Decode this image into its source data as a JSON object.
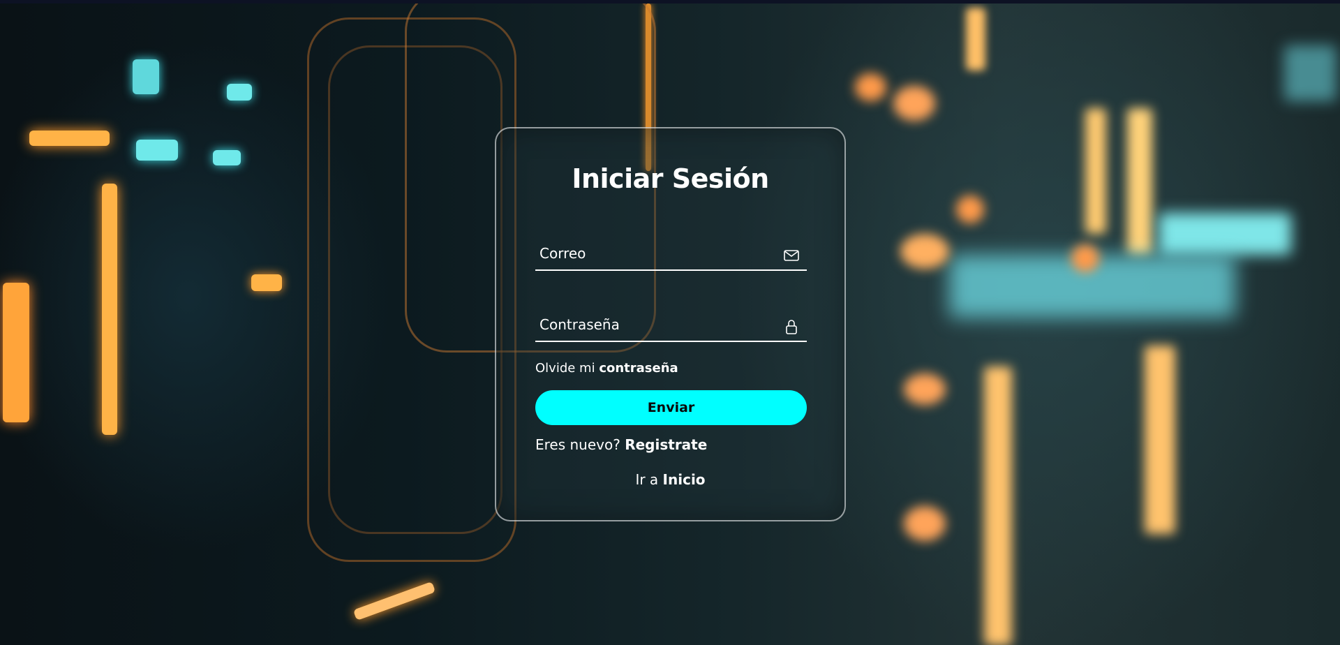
{
  "login": {
    "title": "Iniciar Sesión",
    "email_placeholder": "Correo",
    "password_placeholder": "Contraseña",
    "forgot_prefix": "Olvide mi",
    "forgot_link": "contraseña",
    "submit_label": "Enviar",
    "register_prefix": "Eres nuevo?",
    "register_link": "Registrate",
    "home_prefix": "Ir a",
    "home_link": "Inicio"
  },
  "icons": {
    "email": "mail-icon",
    "password": "lock-icon"
  },
  "colors": {
    "accent": "#00ffff",
    "card_border": "#ffffff",
    "text": "#ffffff"
  }
}
